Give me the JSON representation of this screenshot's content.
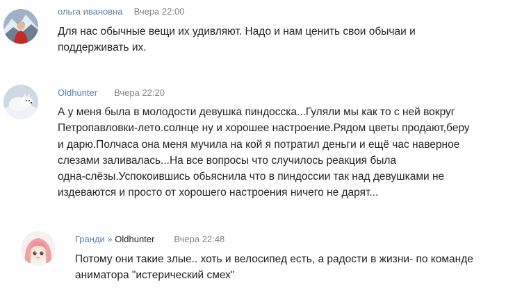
{
  "comments": [
    {
      "author": "ольга ивановна",
      "time": "Вчера 22:00",
      "avatar_icon": "user-photo-red-jacket-mountains",
      "lines": [
        "Для нас обычные вещи их удивляют. Надо и нам ценить свои обычаи и",
        "поддерживать их."
      ]
    },
    {
      "author": "Oldhunter",
      "time": "Вчера 22:20",
      "avatar_icon": "arctic-fox-photo",
      "lines": [
        "А у меня была в молодости девушка пиндосска...Гуляли мы как то с ней вокруг",
        "Петропавловки-лето.солнце ну и хорошее настроение.Рядом цветы продают,беру",
        "и дарю.Полчаса она меня мучила на кой я потратил деньги и ещё час наверное",
        "слезами заливалась...На все вопросы что случилось реакция была",
        "одна-слёзы.Успокоившись обьяснила что в пиндоссии так над девушками не",
        "издеваются и просто от хорошего настроения ничего не дарят..."
      ]
    },
    {
      "author": "Гранди",
      "separator": "»",
      "reply_to": "Oldhunter",
      "time": "Вчера 22:48",
      "avatar_icon": "anime-girl-pink-hair",
      "lines": [
        "Потому они такие злые.. хоть и велосипед есть, а радости в жизни- по команде",
        "аниматора \"истерический смех\""
      ]
    }
  ],
  "colors": {
    "author_link": "#5b7fa6",
    "timestamp": "#828282",
    "text": "#222222",
    "background": "#ffffff"
  }
}
